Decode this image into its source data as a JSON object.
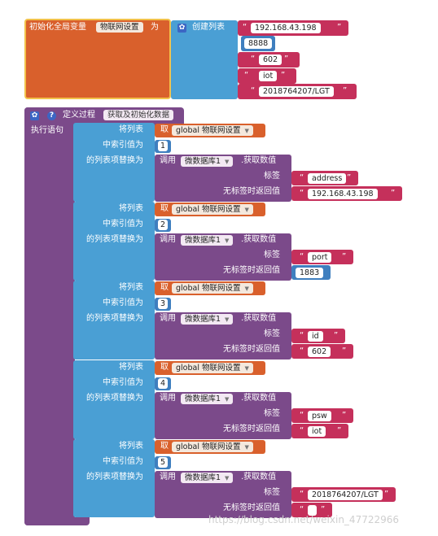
{
  "init": {
    "prefix": "初始化全局变量",
    "var_name": "物联网设置",
    "suffix": "为",
    "create_list": "创建列表",
    "items": [
      "192.168.43.198",
      "8888",
      "602",
      "iot",
      "2018764207/LGT"
    ]
  },
  "proc": {
    "define": "定义过程",
    "name": "获取及初始化数据",
    "exec": "执行语句"
  },
  "labels": {
    "set_list": "将列表",
    "index": "中索引值为",
    "replace": "的列表项替换为",
    "get": "取",
    "global_var": "global 物联网设置",
    "call": "调用",
    "db": "微数据库1",
    "get_value": ".获取数值",
    "tag": "标签",
    "default": "无标签时返回值"
  },
  "groups": [
    {
      "index": "1",
      "tag": "address",
      "default": "192.168.43.198",
      "default_type": "text"
    },
    {
      "index": "2",
      "tag": "port",
      "default": "1883",
      "default_type": "number"
    },
    {
      "index": "3",
      "tag": "id",
      "default": "602",
      "default_type": "text"
    },
    {
      "index": "4",
      "tag": "psw",
      "default": "iot",
      "default_type": "text"
    },
    {
      "index": "5",
      "tag": "2018764207/LGT",
      "default": "",
      "default_type": "text"
    }
  ],
  "watermark": "https://blog.csdn.net/weixin_47722966",
  "colors": {
    "orange": "#d9602c",
    "blue": "#4a9fd4",
    "pink": "#c5305b",
    "purple": "#7b4a8a",
    "number": "#3f7fbf",
    "icon": "#3c66c4"
  },
  "icons": [
    "gear-icon",
    "help-icon",
    "dropdown-caret-icon"
  ]
}
